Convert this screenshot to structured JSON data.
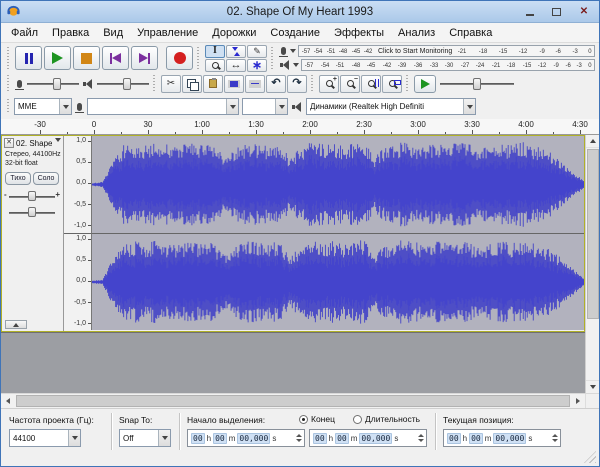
{
  "window": {
    "title": "02. Shape Of My Heart 1993"
  },
  "menu": {
    "items": [
      "Файл",
      "Правка",
      "Вид",
      "Управление",
      "Дорожки",
      "Создание",
      "Эффекты",
      "Анализ",
      "Справка"
    ]
  },
  "meters": {
    "record_scale_left": [
      "-57",
      "-54",
      "-51",
      "-48",
      "-45",
      "-42"
    ],
    "record_monitor_text": "Click to Start Monitoring",
    "record_scale_right": [
      "-21",
      "-18",
      "-15",
      "-12",
      "-9",
      "-6",
      "-3",
      "0"
    ],
    "play_scale": [
      "-57",
      "-54",
      "-51",
      "-48",
      "-45",
      "-42",
      "-39",
      "-36",
      "-33",
      "-30",
      "-27",
      "-24",
      "-21",
      "-18",
      "-15",
      "-12",
      "-9",
      "-6",
      "-3",
      "0"
    ]
  },
  "device": {
    "host": "MME",
    "input": "",
    "channels": "",
    "output": "Динамики (Realtek High Definiti"
  },
  "timeline": {
    "labels": [
      "-30",
      "0",
      "30",
      "1:00",
      "1:30",
      "2:00",
      "2:30",
      "3:00",
      "3:30",
      "4:00",
      "4:30"
    ]
  },
  "track": {
    "name": "02. Shape",
    "info_line1": "Стерео, 44100Hz",
    "info_line2": "32-bit float",
    "mute_label": "Тихо",
    "solo_label": "Соло",
    "gain_minus": "-",
    "gain_plus": "+",
    "vruler_labels": [
      "1,0",
      "0,5",
      "0,0",
      "-0,5",
      "-1,0"
    ]
  },
  "waveform": {
    "bg": "#b2b2be",
    "peak_color": "#3c3cc8",
    "rms_color": "#7474e0",
    "envelope": [
      0.03,
      0.06,
      0.55,
      0.88,
      0.92,
      0.86,
      0.94,
      0.9,
      0.82,
      0.93,
      0.88,
      0.95,
      0.78,
      0.6,
      0.9,
      0.94,
      0.88,
      0.92,
      0.85,
      0.58,
      0.86,
      0.95,
      0.9,
      0.93,
      0.86,
      0.91,
      0.95,
      0.62,
      0.84,
      0.93,
      0.95,
      0.89,
      0.87,
      0.93,
      0.86,
      0.95,
      0.9,
      0.78,
      0.86,
      0.92,
      0.88,
      0.95,
      0.9,
      0.84,
      0.7,
      0.52,
      0.3,
      0.08
    ]
  },
  "statusbar": {
    "rate_label": "Частота проекта (Гц):",
    "rate_value": "44100",
    "snap_label": "Snap To:",
    "snap_value": "Off",
    "selection_label": "Начало выделения:",
    "radio_end_label": "Конец",
    "radio_length_label": "Длительность",
    "position_label": "Текущая позиция:",
    "time": {
      "h": "00",
      "m": "00",
      "s": "00,000",
      "unit_h": "h",
      "unit_m": "m",
      "unit_s": "s"
    }
  }
}
